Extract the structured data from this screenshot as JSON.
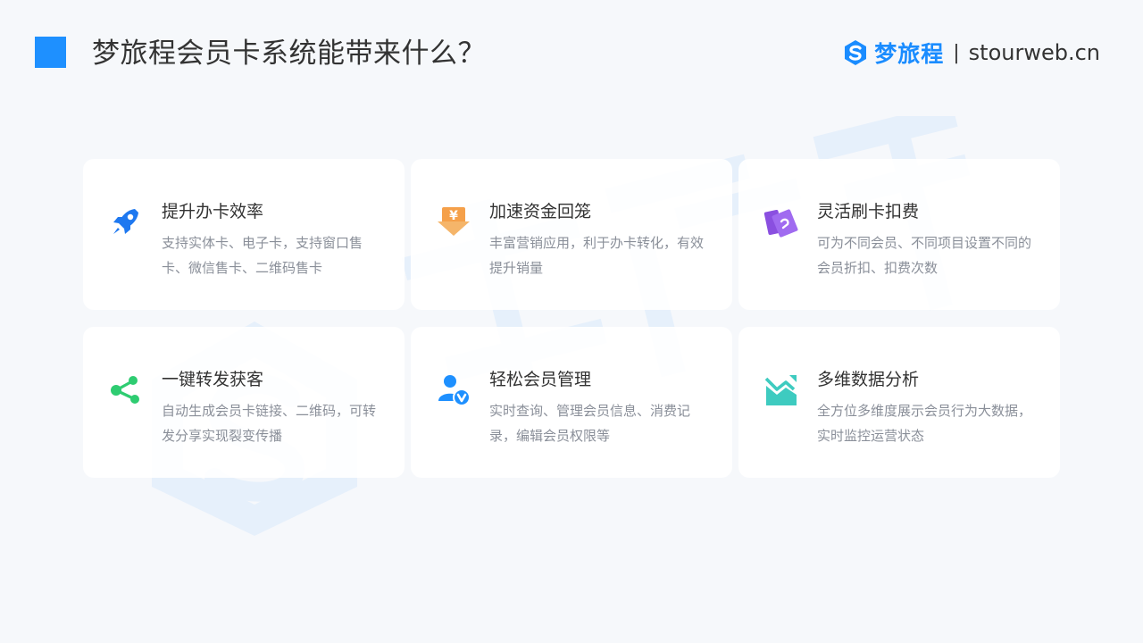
{
  "header": {
    "title": "梦旅程会员卡系统能带来什么？",
    "brand_name": "梦旅程",
    "brand_separator": "|",
    "brand_url": "stourweb.cn"
  },
  "colors": {
    "accent": "#1e90ff",
    "brand": "#1a8cff",
    "rocket": "#1e78f0",
    "coin": "#f5a04a",
    "card_swipe": "#8a4fe0",
    "share": "#2ecc71",
    "member": "#1e90ff",
    "chart": "#3ecbc0"
  },
  "cards": [
    {
      "icon": "rocket-icon",
      "title": "提升办卡效率",
      "desc": "支持实体卡、电子卡，支持窗口售卡、微信售卡、二维码售卡"
    },
    {
      "icon": "yuan-coin-icon",
      "title": "加速资金回笼",
      "desc": "丰富营销应用，利于办卡转化，有效提升销量"
    },
    {
      "icon": "card-swipe-icon",
      "title": "灵活刷卡扣费",
      "desc": "可为不同会员、不同项目设置不同的会员折扣、扣费次数"
    },
    {
      "icon": "share-icon",
      "title": "一键转发获客",
      "desc": "自动生成会员卡链接、二维码，可转发分享实现裂变传播"
    },
    {
      "icon": "member-verified-icon",
      "title": "轻松会员管理",
      "desc": "实时查询、管理会员信息、消费记录，编辑会员权限等"
    },
    {
      "icon": "trend-chart-icon",
      "title": "多维数据分析",
      "desc": "全方位多维度展示会员行为大数据，实时监控运营状态"
    }
  ]
}
